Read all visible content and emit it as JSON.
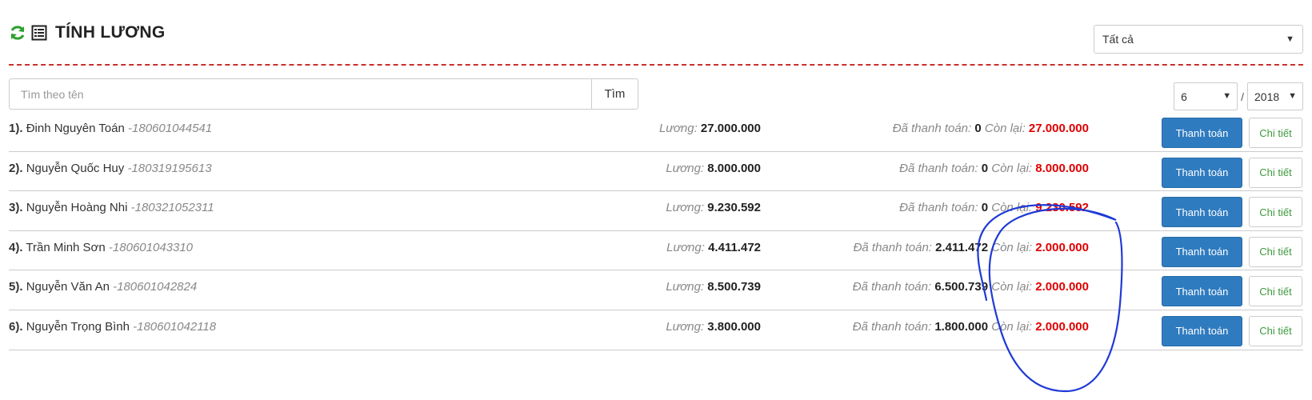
{
  "header": {
    "title": "TÍNH LƯƠNG",
    "filter_value": "Tất cả"
  },
  "search": {
    "placeholder": "Tìm theo tên",
    "button_label": "Tìm"
  },
  "period": {
    "month": "6",
    "separator": "/",
    "year": "2018"
  },
  "labels": {
    "salary": "Lương:",
    "paid": "Đã thanh toán:",
    "remaining": "Còn lại:",
    "pay_button": "Thanh toán",
    "detail_button": "Chi tiết"
  },
  "rows": [
    {
      "index": "1).",
      "name": "Đinh Nguyên Toán",
      "code": "-180601044541",
      "salary": "27.000.000",
      "paid": "0",
      "remaining": "27.000.000"
    },
    {
      "index": "2).",
      "name": "Nguyễn Quốc Huy",
      "code": "-180319195613",
      "salary": "8.000.000",
      "paid": "0",
      "remaining": "8.000.000"
    },
    {
      "index": "3).",
      "name": "Nguyễn Hoàng Nhi",
      "code": "-180321052311",
      "salary": "9.230.592",
      "paid": "0",
      "remaining": "9.230.592"
    },
    {
      "index": "4).",
      "name": "Trần Minh Sơn",
      "code": "-180601043310",
      "salary": "4.411.472",
      "paid": "2.411.472",
      "remaining": "2.000.000"
    },
    {
      "index": "5).",
      "name": "Nguyễn Văn An",
      "code": "-180601042824",
      "salary": "8.500.739",
      "paid": "6.500.739",
      "remaining": "2.000.000"
    },
    {
      "index": "6).",
      "name": "Nguyễn Trọng Bình",
      "code": "-180601042118",
      "salary": "3.800.000",
      "paid": "1.800.000",
      "remaining": "2.000.000"
    }
  ],
  "colors": {
    "primary_button": "#2f7bbf",
    "remaining_value": "#e00000",
    "divider": "#c9302c",
    "refresh_icon": "#2ca02c",
    "annotation_ink": "#1f3ad6"
  },
  "icons": {
    "refresh": "refresh-icon",
    "list": "list-icon",
    "dropdown": "chevron-down-icon"
  }
}
